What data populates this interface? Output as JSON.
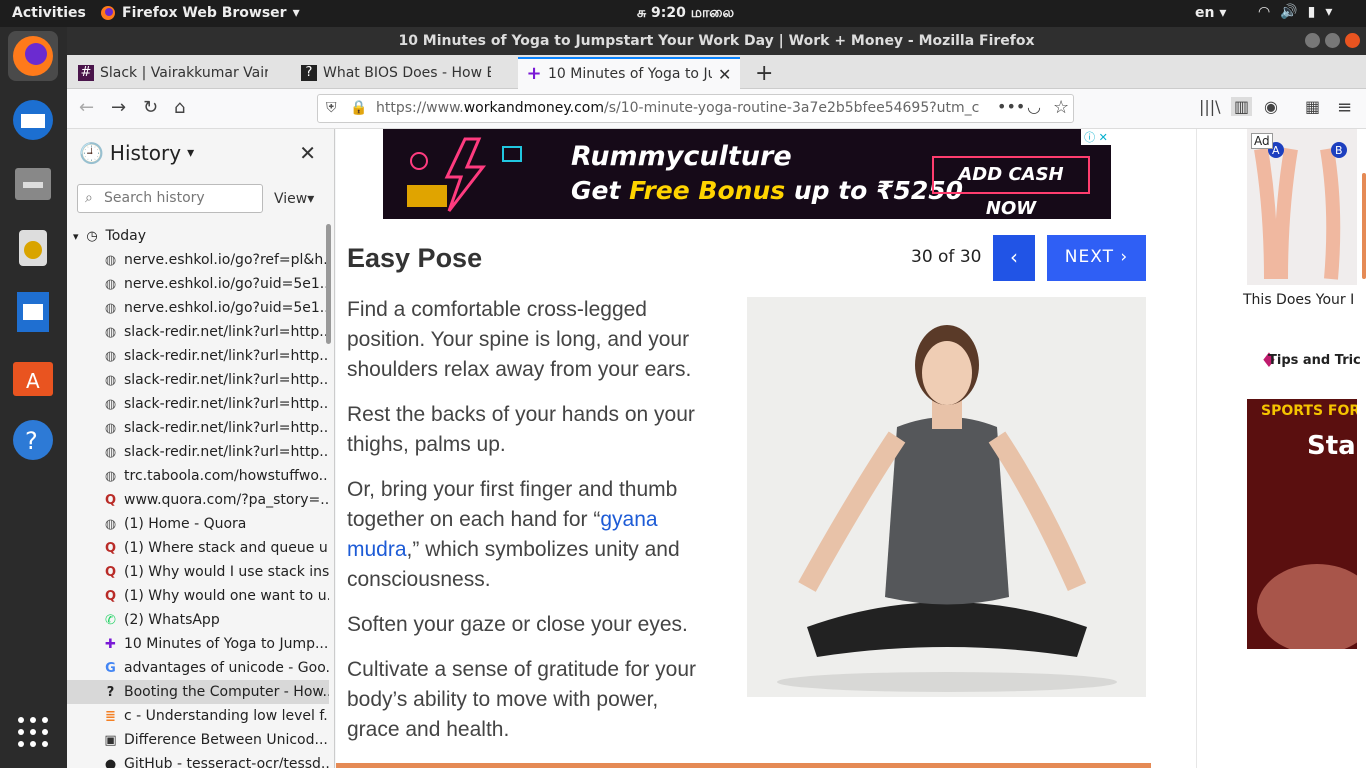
{
  "topbar": {
    "activities": "Activities",
    "app": "Firefox Web Browser",
    "clock": "சு 9:20 மாலை",
    "lang": "en"
  },
  "window": {
    "title": "10 Minutes of Yoga to Jumpstart Your Work Day | Work + Money - Mozilla Firefox"
  },
  "tabs": [
    {
      "label": "Slack | Vairakkumar Vaira"
    },
    {
      "label": "What BIOS Does - How B"
    },
    {
      "label": "10 Minutes of Yoga to Ju"
    }
  ],
  "url": {
    "prefix": "https://www.",
    "domain": "workandmoney.com",
    "rest": "/s/10-minute-yoga-routine-3a7e2b5bfee54695?utm_c"
  },
  "sidebar": {
    "title": "History",
    "search_placeholder": "Search history",
    "view": "View",
    "today": "Today",
    "items": [
      {
        "label": "nerve.eshkol.io/go?ref=pl&h...",
        "icon": "globe"
      },
      {
        "label": "nerve.eshkol.io/go?uid=5e1...",
        "icon": "globe"
      },
      {
        "label": "nerve.eshkol.io/go?uid=5e1...",
        "icon": "globe"
      },
      {
        "label": "slack-redir.net/link?url=http...",
        "icon": "globe"
      },
      {
        "label": "slack-redir.net/link?url=http...",
        "icon": "globe"
      },
      {
        "label": "slack-redir.net/link?url=http...",
        "icon": "globe"
      },
      {
        "label": "slack-redir.net/link?url=http...",
        "icon": "globe"
      },
      {
        "label": "slack-redir.net/link?url=http...",
        "icon": "globe"
      },
      {
        "label": "slack-redir.net/link?url=http...",
        "icon": "globe"
      },
      {
        "label": "trc.taboola.com/howstuffwo...",
        "icon": "globe"
      },
      {
        "label": "www.quora.com/?pa_story=...",
        "icon": "quora"
      },
      {
        "label": "(1) Home - Quora",
        "icon": "globe"
      },
      {
        "label": "(1) Where stack and queue u...",
        "icon": "quora"
      },
      {
        "label": "(1) Why would I use stack ins...",
        "icon": "quora"
      },
      {
        "label": "(1) Why would one want to u...",
        "icon": "quora"
      },
      {
        "label": "(2) WhatsApp",
        "icon": "whatsapp"
      },
      {
        "label": "10 Minutes of Yoga to Jump...",
        "icon": "plus"
      },
      {
        "label": "advantages of unicode - Goo...",
        "icon": "google"
      },
      {
        "label": "Booting the Computer - How...",
        "icon": "howstuff"
      },
      {
        "label": "c - Understanding low level f...",
        "icon": "stackoverflow"
      },
      {
        "label": "Difference Between Unicod...",
        "icon": "db"
      },
      {
        "label": "GitHub - tesseract-ocr/tessd...",
        "icon": "github"
      }
    ]
  },
  "ad": {
    "brand": "Rummyculture",
    "promo_start": "Get ",
    "promo_highlight": "Free Bonus",
    "promo_end": " up to ₹5250",
    "cta": "ADD CASH NOW"
  },
  "page": {
    "title": "Easy Pose",
    "counter": "30 of 30",
    "prev": "‹",
    "next": "NEXT ›",
    "p1": "Find a comfortable cross-legged position. Your spine is long, and your shoulders relax away from your ears.",
    "p2": "Rest the backs of your hands on your thighs, palms up.",
    "p3_start": "Or, bring your first finger and thumb together on each hand for “",
    "p3_link": "gyana mudra",
    "p3_end": ",” which symbolizes unity and consciousness.",
    "p4": "Soften your gaze or close your eyes.",
    "p5": "Cultivate a sense of gratitude for your body’s ability to move with power, grace and health."
  },
  "rightads": {
    "ad_label": "Ad",
    "label_a": "A",
    "label_b": "B",
    "caption": "This Does Your I",
    "tips": "Tips and Tric",
    "sports": "SPORTS FOR",
    "sta": "Sta"
  }
}
